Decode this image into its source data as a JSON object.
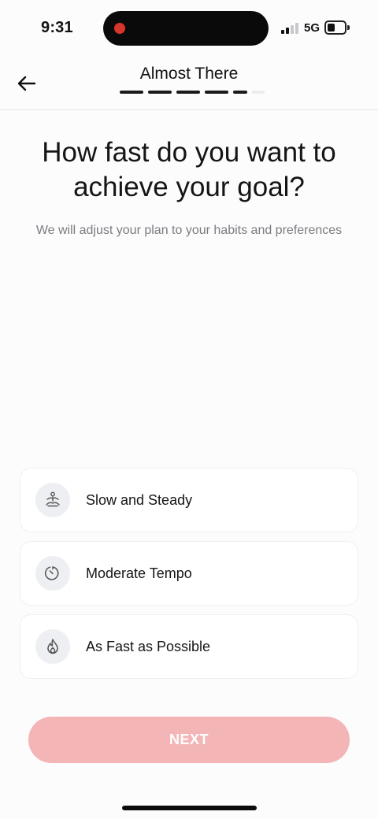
{
  "status_bar": {
    "time": "9:31",
    "network": "5G"
  },
  "header": {
    "title": "Almost There",
    "progress": {
      "total_segments": 6,
      "completed_segments": 5
    }
  },
  "question": {
    "title": "How fast do you want to achieve your goal?",
    "subtitle": "We will adjust your plan to your habits and preferences"
  },
  "options": [
    {
      "label": "Slow and Steady",
      "icon": "meditation-icon"
    },
    {
      "label": "Moderate Tempo",
      "icon": "timer-icon"
    },
    {
      "label": "As Fast as Possible",
      "icon": "fire-icon"
    }
  ],
  "next_button": {
    "label": "NEXT",
    "enabled": false
  },
  "colors": {
    "accent_disabled": "#f4b5b7",
    "recording_dot": "#d6362b",
    "progress_active": "#1a1a1a",
    "progress_inactive": "#ececee"
  }
}
